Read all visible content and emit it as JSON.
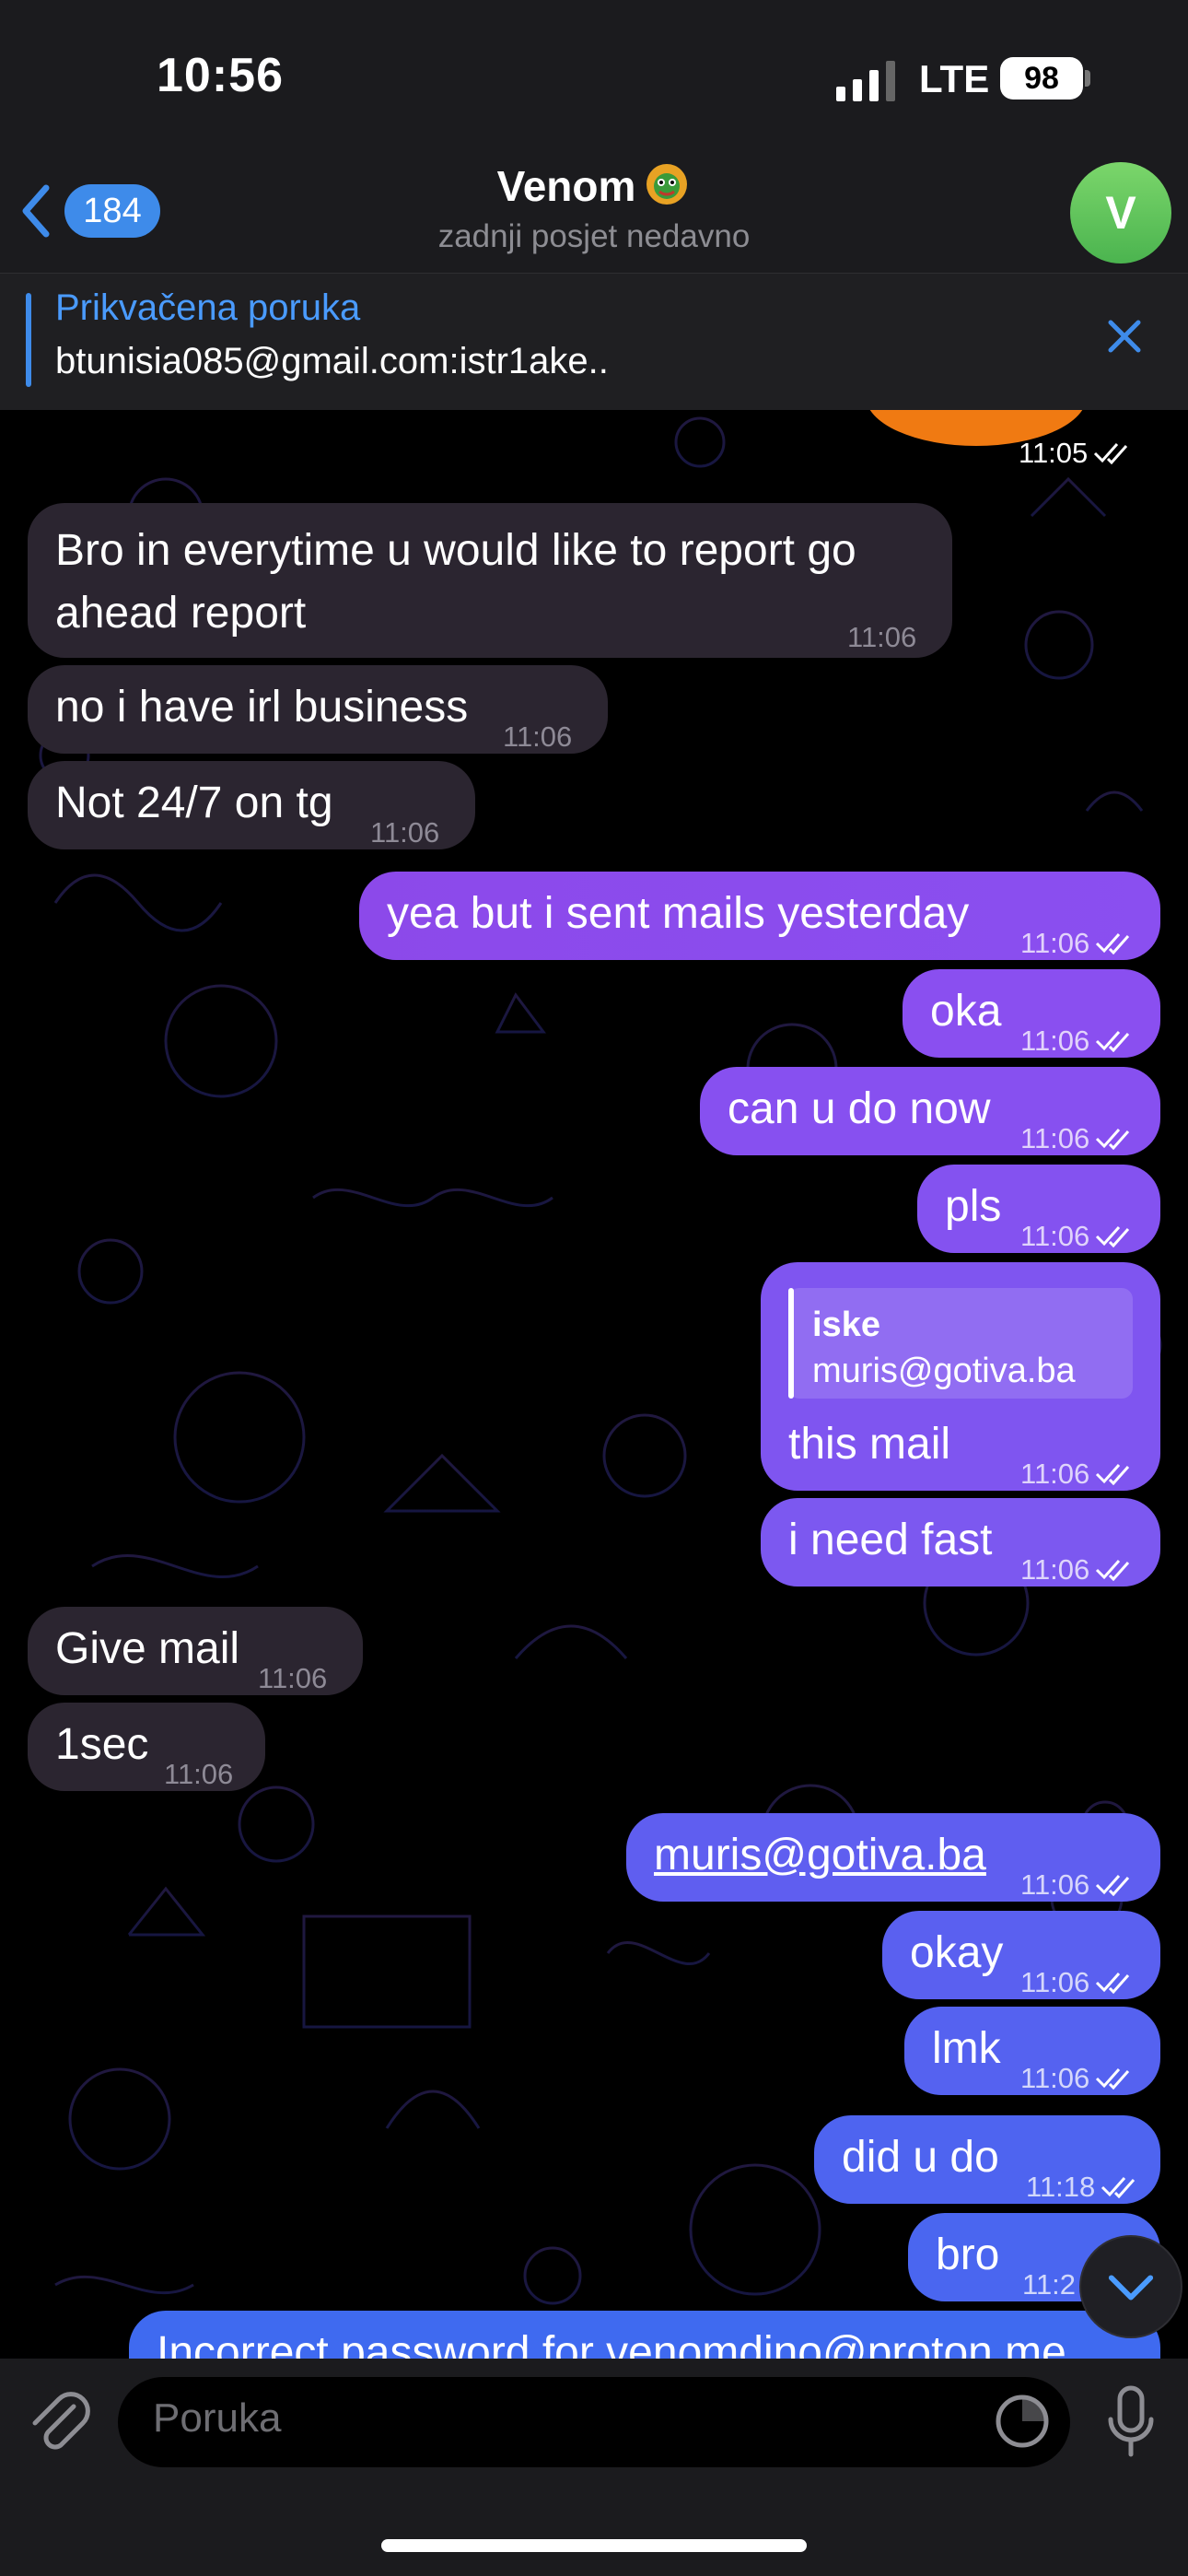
{
  "status_bar": {
    "time": "10:56",
    "network": "LTE",
    "battery": "98"
  },
  "header": {
    "back_count": "184",
    "title": "Venom",
    "subtitle": "zadnji posjet nedavno",
    "avatar_letter": "V"
  },
  "pinned": {
    "title": "Prikvačena poruka",
    "text": "btunisia085@gmail.com:istr1ake.."
  },
  "messages": [
    {
      "dir": "out",
      "time": "11:05"
    },
    {
      "dir": "in",
      "text_line1": "Bro in everytime u would like to report go",
      "text_line2": "ahead report",
      "time": "11:06"
    },
    {
      "dir": "in",
      "text": "no i have irl business",
      "time": "11:06"
    },
    {
      "dir": "in",
      "text": "Not 24/7 on tg",
      "time": "11:06"
    },
    {
      "dir": "out",
      "text": "yea but i sent mails yesterday",
      "time": "11:06"
    },
    {
      "dir": "out",
      "text": "oka",
      "time": "11:06"
    },
    {
      "dir": "out",
      "text": "can u do now",
      "time": "11:06"
    },
    {
      "dir": "out",
      "text": "pls",
      "time": "11:06"
    },
    {
      "dir": "out",
      "reply_name": "iske",
      "reply_text": "muris@gotiva.ba",
      "text": "this mail",
      "time": "11:06"
    },
    {
      "dir": "out",
      "text": "i need fast",
      "time": "11:06"
    },
    {
      "dir": "in",
      "text": "Give mail",
      "time": "11:06"
    },
    {
      "dir": "in",
      "text": "1sec",
      "time": "11:06"
    },
    {
      "dir": "out",
      "text": "muris@gotiva.ba",
      "time": "11:06"
    },
    {
      "dir": "out",
      "text": "okay",
      "time": "11:06"
    },
    {
      "dir": "out",
      "text": "lmk",
      "time": "11:06"
    },
    {
      "dir": "out",
      "text": "did u do",
      "time": "11:18"
    },
    {
      "dir": "out",
      "text": "bro",
      "time": "11:2"
    },
    {
      "dir": "out",
      "text": "Incorrect password for venomdino@proton.me"
    }
  ],
  "composer": {
    "placeholder": "Poruka"
  },
  "colors": {
    "accent": "#3e8bea",
    "bubble_in": "#2b2530",
    "bubble_purple": "#8a4ff0",
    "bubble_blue": "#4a63f0"
  },
  "icons": [
    "back-chevron-icon",
    "close-icon",
    "attach-icon",
    "sticker-icon",
    "microphone-icon",
    "scroll-down-icon",
    "read-ticks-icon"
  ]
}
